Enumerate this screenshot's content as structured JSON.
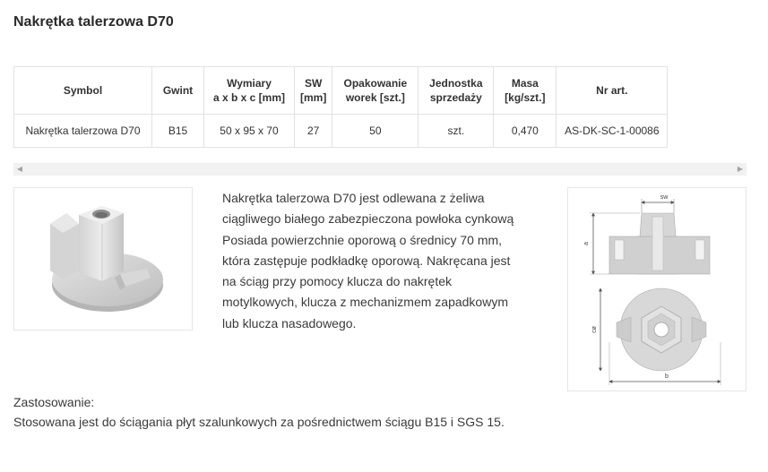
{
  "page": {
    "title": "Nakrętka talerzowa D70"
  },
  "table": {
    "headers": [
      [
        "Symbol"
      ],
      [
        "Gwint"
      ],
      [
        "Wymiary",
        "a x b x c [mm]"
      ],
      [
        "SW",
        "[mm]"
      ],
      [
        "Opakowanie",
        "worek [szt.]"
      ],
      [
        "Jednostka",
        "sprzedaży"
      ],
      [
        "Masa",
        "[kg/szt.]"
      ],
      [
        "Nr art."
      ]
    ],
    "rows": [
      [
        "Nakrętka talerzowa D70",
        "B15",
        "50 x 95 x 70",
        "27",
        "50",
        "szt.",
        "0,470",
        "AS-DK-SC-1-00086"
      ]
    ]
  },
  "scrollbar": {
    "left_arrow_icon": "triangle-left-icon",
    "right_arrow_icon": "triangle-right-icon"
  },
  "description": {
    "lines": [
      "Nakrętka talerzowa D70 jest odlewana z żeliwa",
      "ciągliwego białego zabezpieczona powłoka cynkową",
      "Posiada powierzchnie oporową o średnicy 70 mm,",
      "która zastępuje podkładkę oporową. Nakręcana jest",
      "na ściąg przy pomocy klucza do nakrętek",
      "motylkowych, klucza z mechanizmem zapadkowym",
      "lub klucza nasadowego."
    ]
  },
  "drawing": {
    "sw_label": "sw",
    "a_label": "a",
    "c_label": "cø",
    "b_label": "b"
  },
  "usage": {
    "heading": "Zastosowanie:",
    "text": "Stosowana jest do ściągania płyt szalunkowych za pośrednictwem ściągu B15 i SGS 15."
  }
}
